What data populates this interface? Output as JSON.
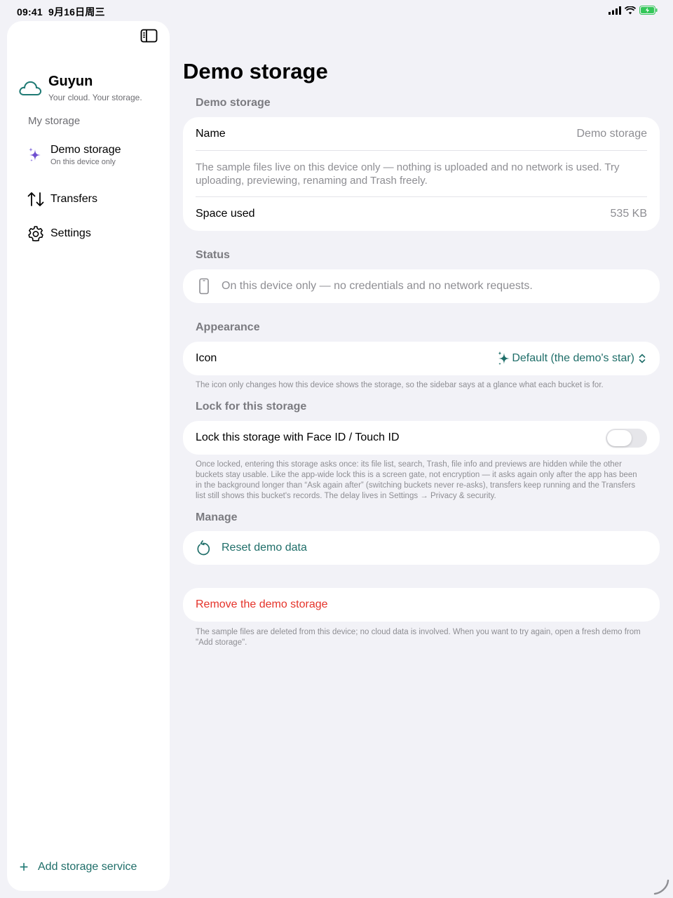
{
  "status_bar": {
    "time": "09:41",
    "date": "9月16日周三"
  },
  "sidebar": {
    "brand": {
      "title": "Guyun",
      "subtitle": "Your cloud. Your storage."
    },
    "section_label": "My storage",
    "items": [
      {
        "label": "Demo storage",
        "sub": "On this device only",
        "icon": "sparkles-icon"
      },
      {
        "label": "Transfers",
        "icon": "arrows-updown-icon"
      },
      {
        "label": "Settings",
        "icon": "gear-icon"
      }
    ],
    "add_service": "Add storage service"
  },
  "main": {
    "title": "Demo storage",
    "info": {
      "group": "Demo storage",
      "name_label": "Name",
      "name_value": "Demo storage",
      "description": "The sample files live on this device only — nothing is uploaded and no network is used. Try uploading, previewing, renaming and Trash freely.",
      "space_label": "Space used",
      "space_value": "535 KB"
    },
    "status": {
      "group": "Status",
      "text": "On this device only — no credentials and no network requests."
    },
    "appearance": {
      "group": "Appearance",
      "icon_label": "Icon",
      "icon_value": "Default (the demo's star)",
      "footnote": "The icon only changes how this device shows the storage, so the sidebar says at a glance what each bucket is for."
    },
    "lock": {
      "group": "Lock for this storage",
      "label": "Lock this storage with Face ID / Touch ID",
      "enabled": false,
      "footnote": "Once locked, entering this storage asks once: its file list, search, Trash, file info and previews are hidden while the other buckets stay usable. Like the app-wide lock this is a screen gate, not encryption — it asks again only after the app has been in the background longer than “Ask again after” (switching buckets never re-asks), transfers keep running and the Transfers list still shows this bucket's records. The delay lives in Settings → Privacy & security."
    },
    "manage": {
      "group": "Manage",
      "reset_label": "Reset demo data",
      "remove_label": "Remove the demo storage",
      "footnote": "The sample files are deleted from this device; no cloud data is involved. When you want to try again, open a fresh demo from \"Add storage\"."
    }
  },
  "colors": {
    "accent": "#1f6e69",
    "destructive": "#e5332a",
    "sparkle": "#6f4fd0"
  }
}
